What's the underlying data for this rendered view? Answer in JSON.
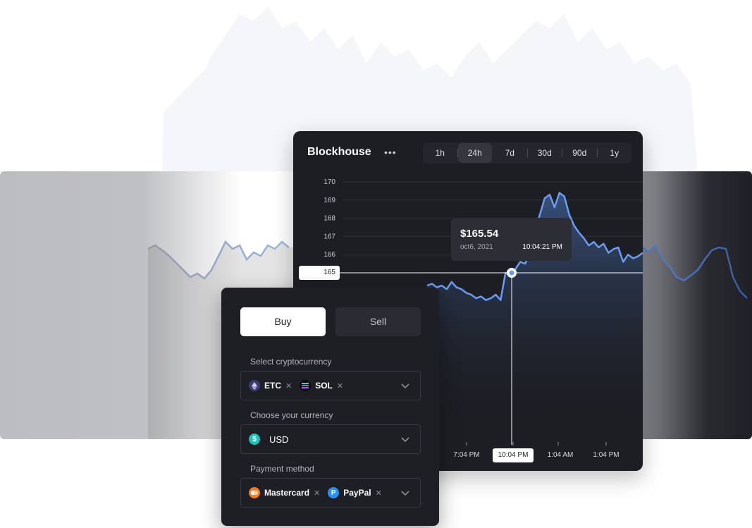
{
  "chart": {
    "title": "Blockhouse",
    "range_tabs": [
      {
        "label": "1h",
        "active": false
      },
      {
        "label": "24h",
        "active": true
      },
      {
        "label": "7d",
        "active": false
      },
      {
        "label": "30d",
        "active": false
      },
      {
        "label": "90d",
        "active": false
      },
      {
        "label": "1y",
        "active": false
      }
    ],
    "y_ticks": [
      "170",
      "169",
      "168",
      "167",
      "166",
      "165"
    ],
    "current_value": "165",
    "x_ticks": [
      {
        "label": "7:04 PM",
        "selected": false
      },
      {
        "label": "10:04 PM",
        "selected": true
      },
      {
        "label": "1:04 AM",
        "selected": false
      },
      {
        "label": "1:04 PM",
        "selected": false
      }
    ],
    "tooltip": {
      "price": "$165.54",
      "date": "oct6, 2021",
      "time": "10:04:21 PM"
    },
    "line_color": "#6c9cf0"
  },
  "chart_data": {
    "type": "line",
    "series": [
      {
        "values": [
          164.3,
          164.4,
          164.2,
          164.3,
          164.1,
          164.5,
          164.2,
          164.1,
          163.9,
          163.8,
          163.6,
          163.7,
          163.5,
          163.6,
          163.8,
          163.5,
          165.0,
          164.9,
          165.2,
          165.6,
          165.5,
          166.1,
          167.3,
          168.2,
          169.1,
          169.3,
          168.6,
          169.4,
          169.2,
          168.2,
          167.6,
          167.2,
          166.9,
          166.5,
          166.7,
          166.4,
          166.6,
          166.1,
          166.3,
          166.4,
          165.6,
          166.0,
          165.8,
          165.9,
          166.1
        ],
        "color": "#6c9cf0"
      }
    ],
    "ylim": [
      162,
      170.5
    ],
    "y_ticks": [
      165,
      166,
      167,
      168,
      169,
      170
    ],
    "highlight": {
      "value": 165.54,
      "date": "oct6, 2021",
      "time": "10:04:21 PM"
    }
  },
  "trade": {
    "buy_label": "Buy",
    "sell_label": "Sell",
    "crypto_label": "Select cryptocurrency",
    "crypto_chips": [
      {
        "label": "ETC",
        "icon": "ethereum-icon",
        "color": "#3a3b6e"
      },
      {
        "label": "SOL",
        "icon": "solana-icon",
        "color": "#0b0b0f"
      }
    ],
    "currency_label": "Choose your currency",
    "currency_value": "USD",
    "currency_icon": "dollar-icon",
    "payment_label": "Payment method",
    "payment_chips": [
      {
        "label": "Mastercard",
        "icon": "mastercard-icon",
        "color": "#f57b20"
      },
      {
        "label": "PayPal",
        "icon": "paypal-icon",
        "color": "#2a8ff7"
      }
    ]
  },
  "colors": {
    "card_bg": "#1d1e24",
    "accent_line": "#6c9cf0",
    "usd_icon": "#19c3b5"
  }
}
